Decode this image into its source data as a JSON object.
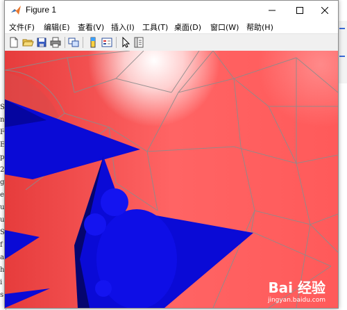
{
  "window": {
    "title": "Figure 1"
  },
  "menu": [
    {
      "label": "文件(F)"
    },
    {
      "label": "编辑(E)"
    },
    {
      "label": "查看(V)"
    },
    {
      "label": "插入(I)"
    },
    {
      "label": "工具(T)"
    },
    {
      "label": "桌面(D)"
    },
    {
      "label": "窗口(W)"
    },
    {
      "label": "帮助(H)"
    }
  ],
  "toolbar": {
    "icons": [
      "new-figure-icon",
      "open-file-icon",
      "save-icon",
      "print-icon",
      "link-plot-icon",
      "insert-colorbar-icon",
      "insert-legend-icon",
      "pointer-icon",
      "property-inspector-icon"
    ]
  },
  "background_app": {
    "left_chars": [
      "S",
      "n",
      "F",
      "E",
      "p",
      "2",
      "g",
      "e",
      "u",
      "u",
      "S",
      "f",
      "a",
      "h",
      "i",
      "s"
    ]
  },
  "watermark": {
    "logo": "Bai 经验",
    "url": "jingyan.baidu.com"
  },
  "colors": {
    "surface": "#ff6464",
    "cone": "#0a0ad6",
    "mesh_line": "#8c8c8c",
    "highlight": "#ffffff"
  }
}
